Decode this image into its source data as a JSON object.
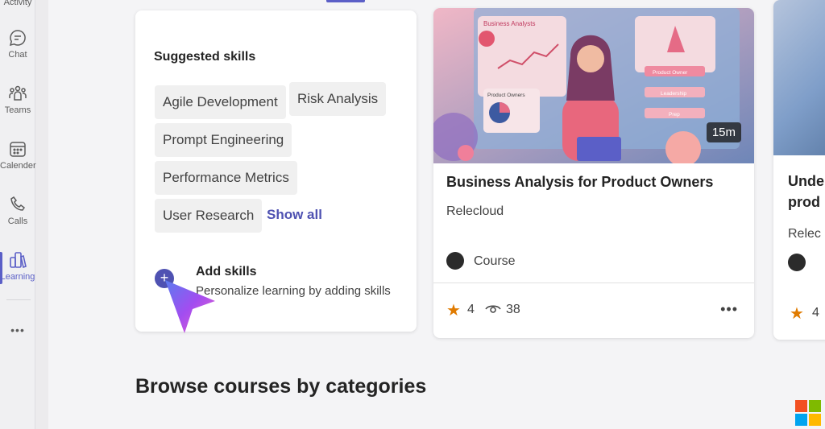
{
  "rail": {
    "items": [
      {
        "label": "Activity"
      },
      {
        "label": "Chat"
      },
      {
        "label": "Teams"
      },
      {
        "label": "Calender"
      },
      {
        "label": "Calls"
      },
      {
        "label": "Learning"
      },
      {
        "label": "•••"
      }
    ]
  },
  "skills": {
    "title": "Suggested skills",
    "chips": [
      "Agile Development",
      "Risk Analysis",
      "Prompt Engineering",
      "Performance Metrics",
      "User Research"
    ],
    "show_all": "Show all",
    "add_title": "Add skills",
    "add_subtitle": "Personalize learning by adding skills"
  },
  "course": {
    "thumbnail_labels": [
      "Business Analysts",
      "Product Owners",
      "Product Owner",
      "Leadership",
      "Prep"
    ],
    "duration": "15m",
    "title": "Business Analysis for Product Owners",
    "provider": "Relecloud",
    "type": "Course",
    "rating": "4",
    "views": "38",
    "more": "•••"
  },
  "course2": {
    "title_line1": "Unde",
    "title_line2": "prod",
    "provider": "Relec",
    "rating": "4"
  },
  "browse": {
    "title": "Browse courses by categories"
  },
  "colors": {
    "accent": "#5b5fc7",
    "star": "#e07b00",
    "link": "#4f52b2"
  }
}
